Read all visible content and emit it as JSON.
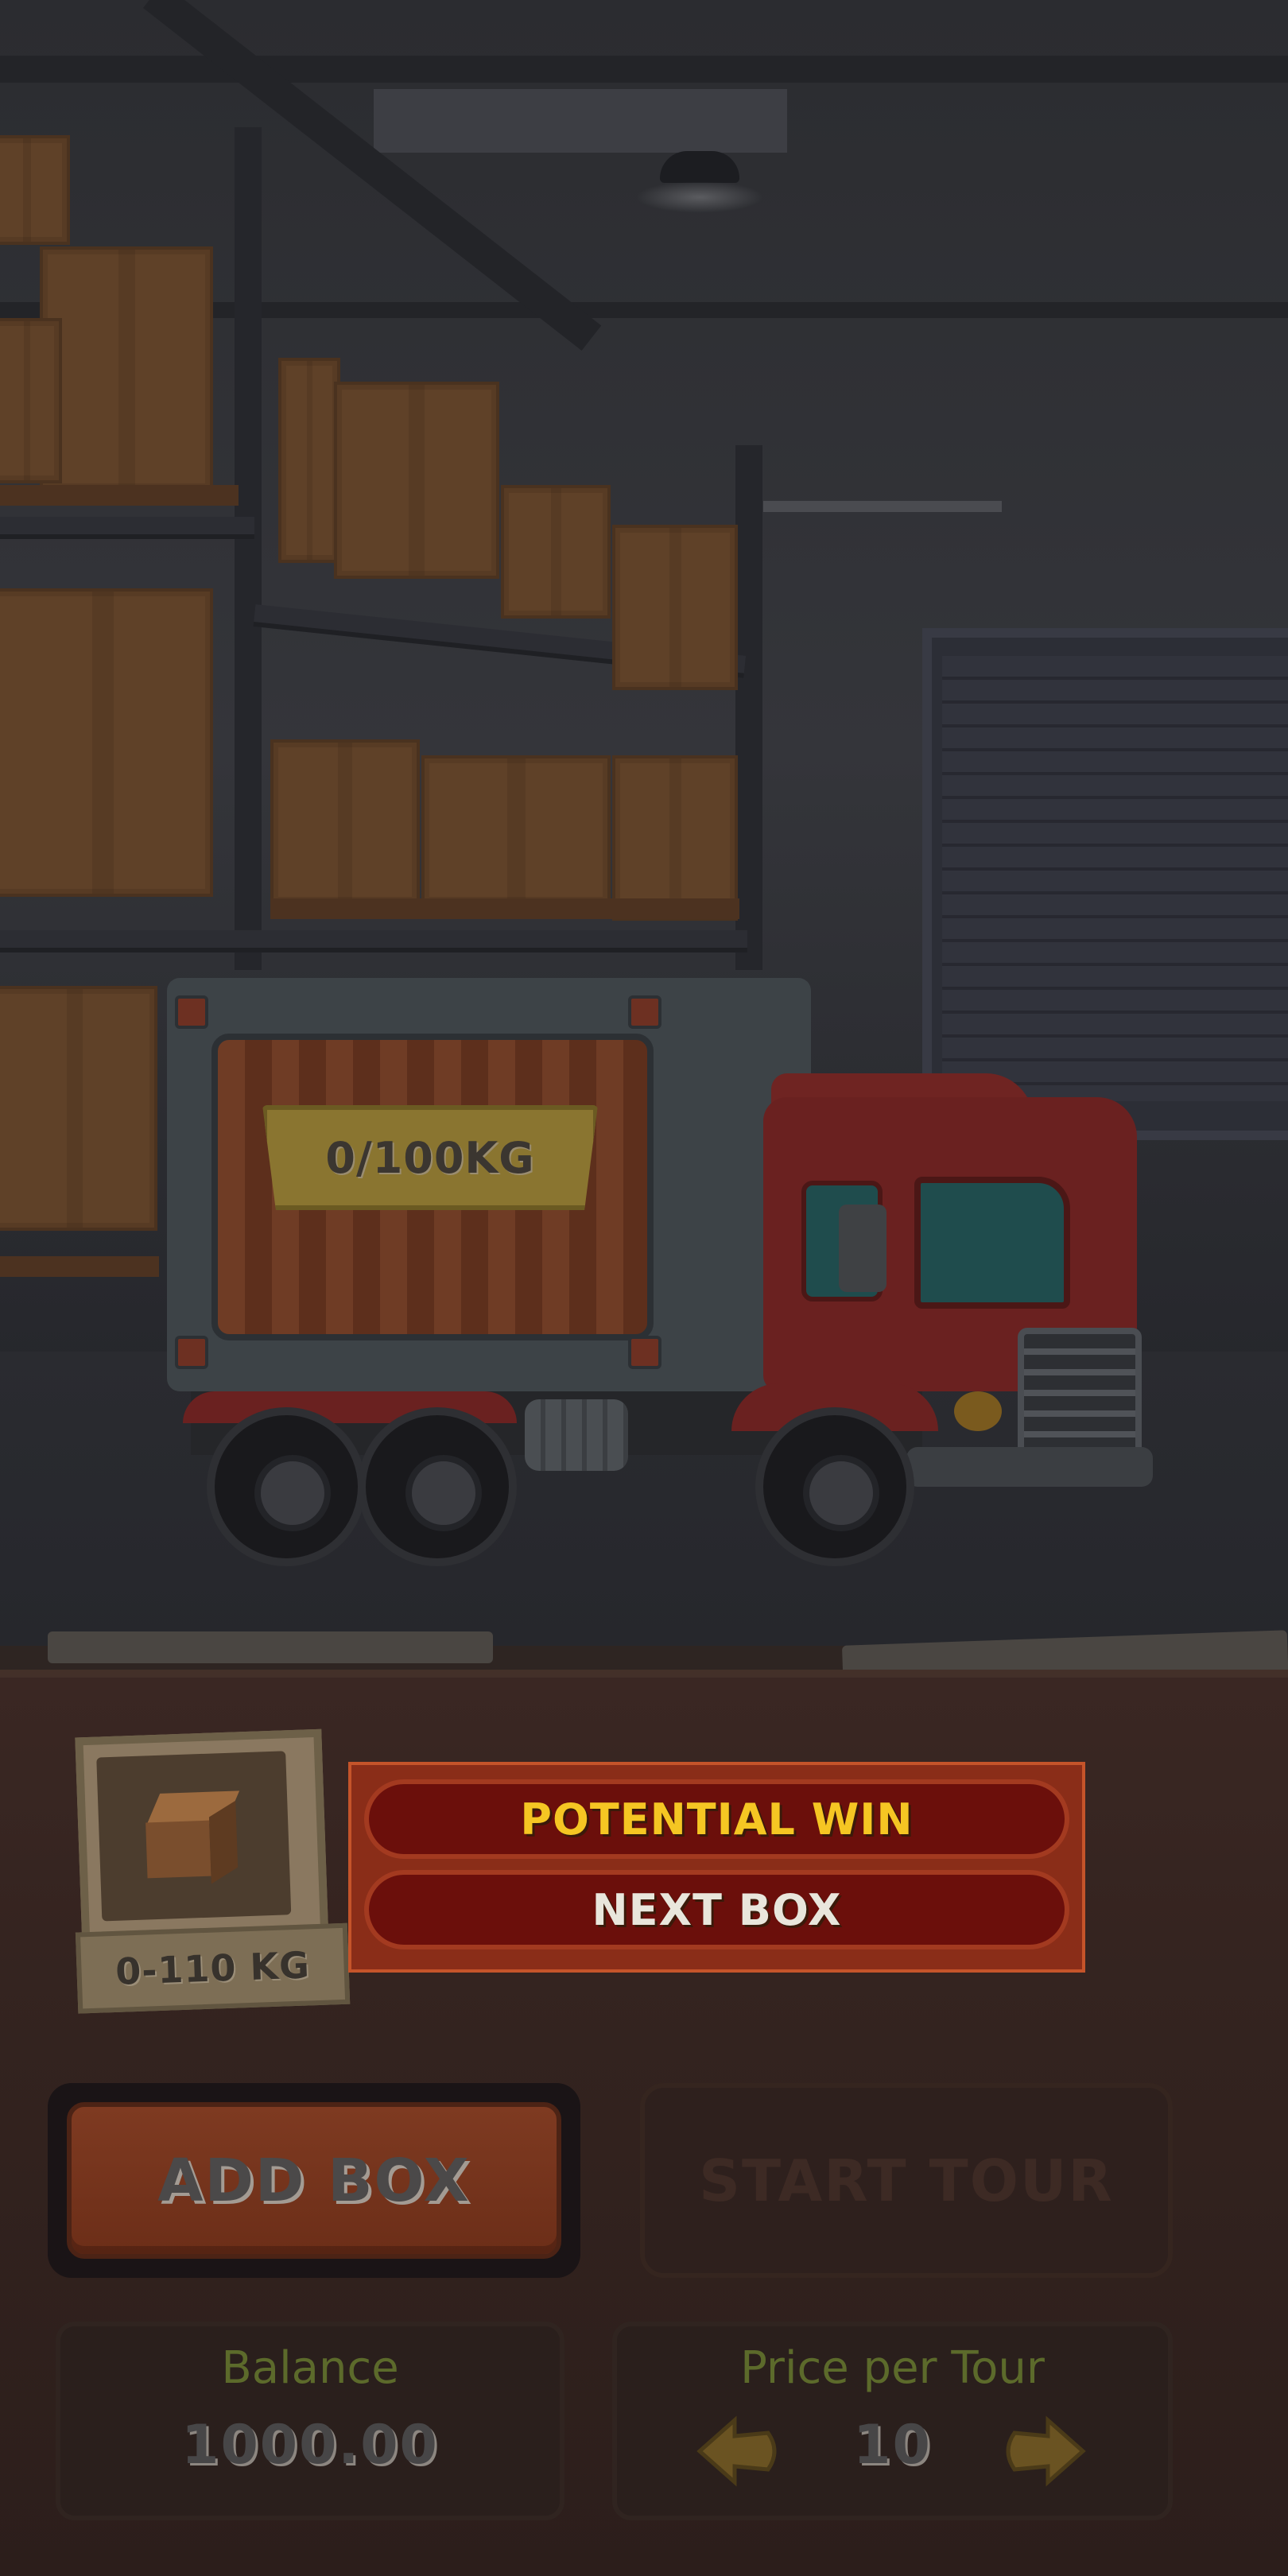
{
  "truck": {
    "load_label": "0/100KG"
  },
  "box_card": {
    "weight_range": "0-110 KG"
  },
  "win_panel": {
    "potential_win_label": "POTENTIAL WIN",
    "next_box_label": "NEXT BOX"
  },
  "actions": {
    "add_box_label": "ADD BOX",
    "start_tour_label": "START TOUR"
  },
  "balance": {
    "title": "Balance",
    "value": "1000.00"
  },
  "price_per_tour": {
    "title": "Price per Tour",
    "value": "10"
  },
  "colors": {
    "potential_win_text": "#f5c623",
    "win_panel_bg": "#8a2d18",
    "add_box_button": "#7e3a21",
    "stat_title": "#5c6a2b"
  },
  "icons": {
    "decrease_price": "arrow-left-icon",
    "increase_price": "arrow-right-icon",
    "box": "cardboard-box-icon"
  }
}
